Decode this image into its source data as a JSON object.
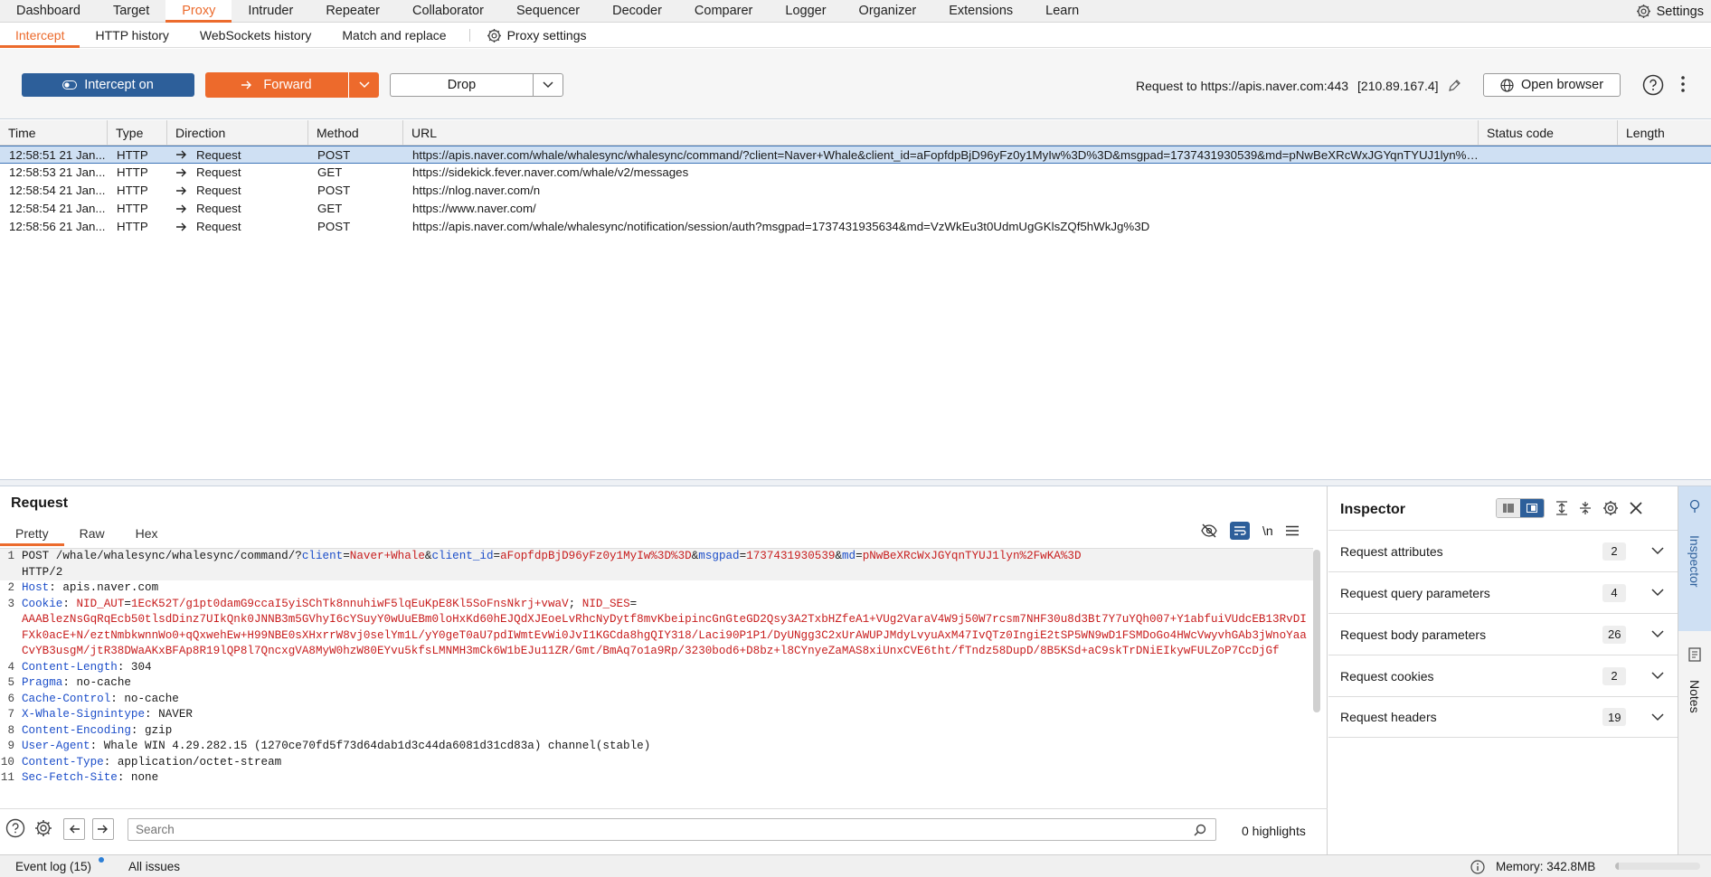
{
  "nav": {
    "tabs": [
      "Dashboard",
      "Target",
      "Proxy",
      "Intruder",
      "Repeater",
      "Collaborator",
      "Sequencer",
      "Decoder",
      "Comparer",
      "Logger",
      "Organizer",
      "Extensions",
      "Learn"
    ],
    "active": "Proxy",
    "settings_label": "Settings"
  },
  "subnav": {
    "tabs": [
      "Intercept",
      "HTTP history",
      "WebSockets history",
      "Match and replace"
    ],
    "active": "Intercept",
    "proxy_settings_label": "Proxy settings"
  },
  "toolbar": {
    "intercept_label": "Intercept on",
    "forward_label": "Forward",
    "drop_label": "Drop",
    "request_to_label": "Request to https://apis.naver.com:443",
    "request_ip": "[210.89.167.4]",
    "open_browser_label": "Open browser"
  },
  "table": {
    "columns": [
      "Time",
      "Type",
      "Direction",
      "Method",
      "URL",
      "Status code",
      "Length"
    ],
    "rows": [
      {
        "time": "12:58:51 21 Jan...",
        "type": "HTTP",
        "direction": "Request",
        "method": "POST",
        "url": "https://apis.naver.com/whale/whalesync/whalesync/command/?client=Naver+Whale&client_id=aFopfdpBjD96yFz0y1MyIw%3D%3D&msgpad=1737431930539&md=pNwBeXRcWxJGYqnTYUJ1lyn%2FwKA%3D",
        "selected": true
      },
      {
        "time": "12:58:53 21 Jan...",
        "type": "HTTP",
        "direction": "Request",
        "method": "GET",
        "url": "https://sidekick.fever.naver.com/whale/v2/messages",
        "selected": false
      },
      {
        "time": "12:58:54 21 Jan...",
        "type": "HTTP",
        "direction": "Request",
        "method": "POST",
        "url": "https://nlog.naver.com/n",
        "selected": false
      },
      {
        "time": "12:58:54 21 Jan...",
        "type": "HTTP",
        "direction": "Request",
        "method": "GET",
        "url": "https://www.naver.com/",
        "selected": false
      },
      {
        "time": "12:58:56 21 Jan...",
        "type": "HTTP",
        "direction": "Request",
        "method": "POST",
        "url": "https://apis.naver.com/whale/whalesync/notification/session/auth?msgpad=1737431935634&md=VzWkEu3t0UdmUgGKlsZQf5hWkJg%3D",
        "selected": false
      }
    ]
  },
  "request": {
    "title": "Request",
    "tabs": [
      "Pretty",
      "Raw",
      "Hex"
    ],
    "active_tab": "Pretty",
    "newline_toggle": "\\n",
    "lines": [
      {
        "n": "1",
        "parts": [
          [
            "pl",
            "POST /whale/whalesync/whalesync/command/?"
          ],
          [
            "hk",
            "client"
          ],
          [
            "pl",
            "="
          ],
          [
            "hv",
            "Naver+Whale"
          ],
          [
            "pl",
            "&"
          ],
          [
            "hk",
            "client_id"
          ],
          [
            "pl",
            "="
          ],
          [
            "hv",
            "aFopfdpBjD96yFz0y1MyIw%3D%3D"
          ],
          [
            "pl",
            "&"
          ],
          [
            "hk",
            "msgpad"
          ],
          [
            "pl",
            "="
          ],
          [
            "hv",
            "1737431930539"
          ],
          [
            "pl",
            "&"
          ],
          [
            "hk",
            "md"
          ],
          [
            "pl",
            "="
          ],
          [
            "hv",
            "pNwBeXRcWxJGYqnTYUJ1lyn%2FwKA%3D"
          ],
          [
            "pl",
            "\nHTTP/2"
          ]
        ]
      },
      {
        "n": "2",
        "parts": [
          [
            "hk",
            "Host"
          ],
          [
            "pl",
            ": apis.naver.com"
          ]
        ]
      },
      {
        "n": "3",
        "parts": [
          [
            "hk",
            "Cookie"
          ],
          [
            "pl",
            ": "
          ],
          [
            "hv",
            "NID_AUT"
          ],
          [
            "pl",
            "="
          ],
          [
            "hv",
            "1EcK52T/g1pt0damG9ccaI5yiSChTk8nnuhiwF5lqEuKpE8Kl5SoFnsNkrj+vwaV"
          ],
          [
            "pl",
            "; "
          ],
          [
            "hv",
            "NID_SES"
          ],
          [
            "pl",
            "=\n"
          ],
          [
            "hv",
            "AAABlezNsGqRqEcb50tlsdDinz7UIkQnk0JNNB3m5GVhyI6cYSuyY0wUuEBm0loHxKd60hEJQdXJEoeLvRhcNyDytf8mvKbeipincGnGteGD2Qsy3A2TxbHZfeA1+VUg2VaraV4W9j50W7rcsm7NHF30u8d3Bt7Y7uYQh007+Y1abfuiVUdcEB13RvDIFXk0acE+N/eztNmbkwnnWo0+qQxwehEw+H99NBE0sXHxrrW8vj0selYm1L/yY0geT0aU7pdIWmtEvWi0JvI1KGCda8hgQIY318/Laci90P1P1/DyUNgg3C2xUrAWUPJMdyLvyuAxM47IvQTz0IngiE2tSP5WN9wD1FSMDoGo4HWcVwyvhGAb3jWnoYaaCvYB3usgM/jtR38DWaAKxBFAp8R19lQP8l7QncxgVA8MyW0hzW80EYvu5kfsLMNMH3mCk6W1bEJu11ZR/Gmt/BmAq7o1a9Rp/3230bod6+D8bz+l8CYnyeZaMAS8xiUnxCVE6tht/fTndz58DupD/8B5KSd+aC9skTrDNiEIkywFULZoP7CcDjGf"
          ]
        ]
      },
      {
        "n": "4",
        "parts": [
          [
            "hk",
            "Content-Length"
          ],
          [
            "pl",
            ": 304"
          ]
        ]
      },
      {
        "n": "5",
        "parts": [
          [
            "hk",
            "Pragma"
          ],
          [
            "pl",
            ": no-cache"
          ]
        ]
      },
      {
        "n": "6",
        "parts": [
          [
            "hk",
            "Cache-Control"
          ],
          [
            "pl",
            ": no-cache"
          ]
        ]
      },
      {
        "n": "7",
        "parts": [
          [
            "hk",
            "X-Whale-Signintype"
          ],
          [
            "pl",
            ": NAVER"
          ]
        ]
      },
      {
        "n": "8",
        "parts": [
          [
            "hk",
            "Content-Encoding"
          ],
          [
            "pl",
            ": gzip"
          ]
        ]
      },
      {
        "n": "9",
        "parts": [
          [
            "hk",
            "User-Agent"
          ],
          [
            "pl",
            ": Whale WIN 4.29.282.15 (1270ce70fd5f73d64dab1d3c44da6081d31cd83a) channel(stable)"
          ]
        ]
      },
      {
        "n": "10",
        "parts": [
          [
            "hk",
            "Content-Type"
          ],
          [
            "pl",
            ": application/octet-stream"
          ]
        ]
      },
      {
        "n": "11",
        "parts": [
          [
            "hk",
            "Sec-Fetch-Site"
          ],
          [
            "pl",
            ": none"
          ]
        ]
      }
    ],
    "search_placeholder": "Search",
    "highlights": "0 highlights"
  },
  "inspector": {
    "title": "Inspector",
    "sections": [
      {
        "label": "Request attributes",
        "count": "2"
      },
      {
        "label": "Request query parameters",
        "count": "4"
      },
      {
        "label": "Request body parameters",
        "count": "26"
      },
      {
        "label": "Request cookies",
        "count": "2"
      },
      {
        "label": "Request headers",
        "count": "19"
      }
    ],
    "rail_inspector": "Inspector",
    "rail_notes": "Notes"
  },
  "status": {
    "event_log": "Event log (15)",
    "all_issues": "All issues",
    "memory": "Memory: 342.8MB",
    "memory_fraction": 0.04
  },
  "colors": {
    "accent": "#ec6b2d",
    "intercept": "#2d5f9a",
    "selection": "#cfe0f3",
    "header_key": "#1c4ec9",
    "header_value": "#c81e1e"
  }
}
